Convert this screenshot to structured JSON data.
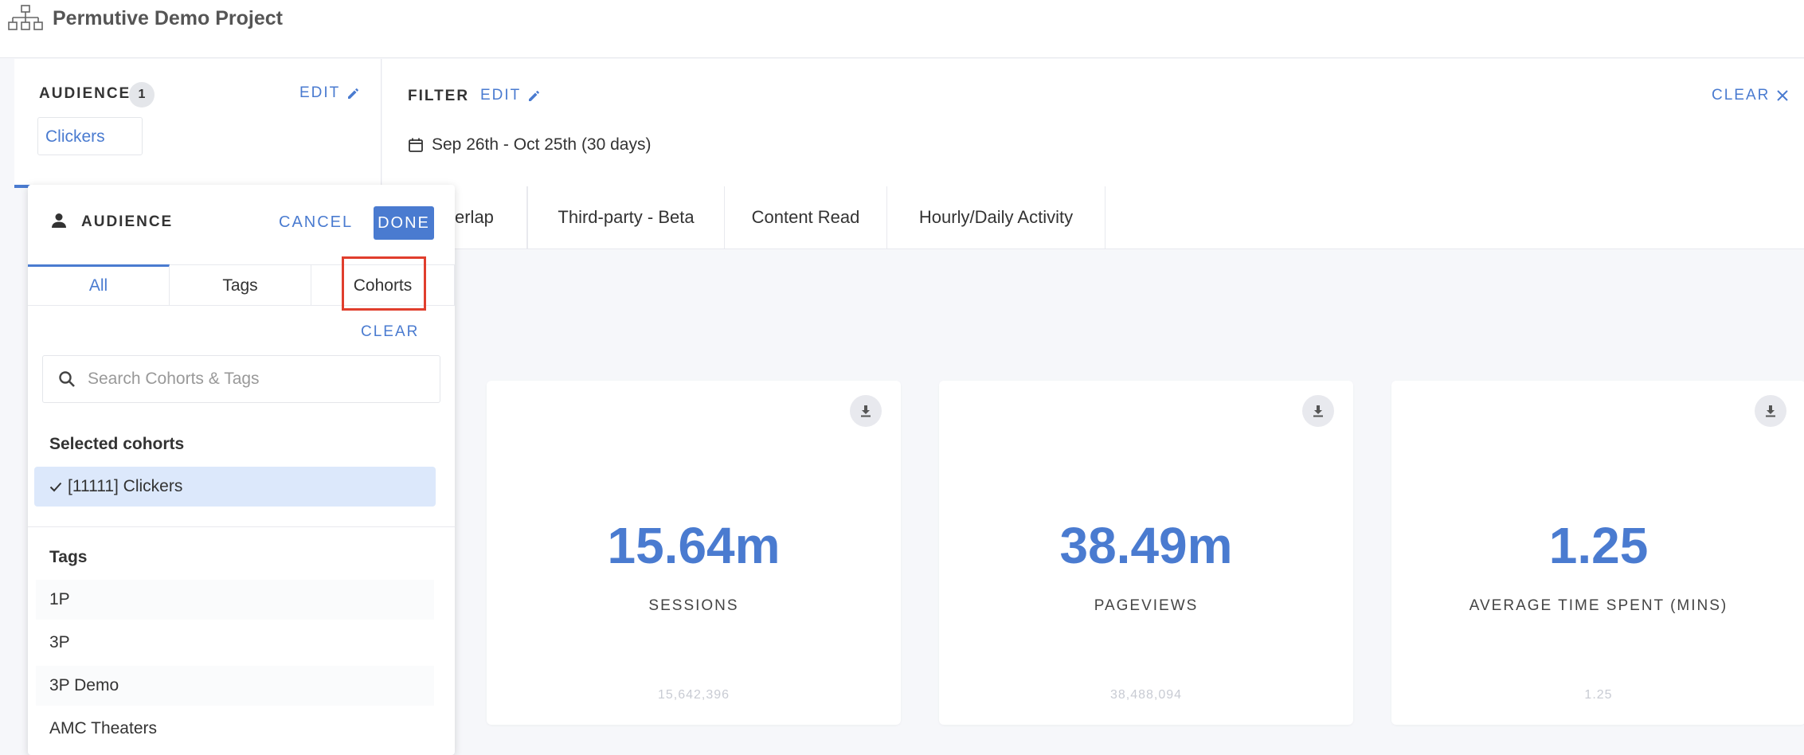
{
  "header": {
    "project_title": "Permutive Demo Project",
    "icon": "sitemap-icon"
  },
  "audience": {
    "label": "AUDIENCE",
    "count": "1",
    "edit_label": "EDIT",
    "chip": "Clickers"
  },
  "filter": {
    "label": "FILTER",
    "edit_label": "EDIT",
    "clear_label": "CLEAR",
    "date_range": "Sep 26th - Oct 25th (30 days)"
  },
  "tabs": [
    {
      "label": "verlap"
    },
    {
      "label": "Third-party - Beta"
    },
    {
      "label": "Content Read"
    },
    {
      "label": "Hourly/Daily Activity"
    }
  ],
  "metrics": [
    {
      "value": "15.64m",
      "label": "SESSIONS",
      "raw": "15,642,396"
    },
    {
      "value": "38.49m",
      "label": "PAGEVIEWS",
      "raw": "38,488,094"
    },
    {
      "value": "1.25",
      "label": "AVERAGE TIME SPENT (MINS)",
      "raw": "1.25"
    }
  ],
  "dropdown": {
    "title": "AUDIENCE",
    "cancel_label": "CANCEL",
    "done_label": "DONE",
    "tabs": [
      "All",
      "Tags",
      "Cohorts"
    ],
    "clear_label": "CLEAR",
    "search_placeholder": "Search Cohorts & Tags",
    "selected_heading": "Selected cohorts",
    "selected_item": "[11111] Clickers",
    "tags_heading": "Tags",
    "tags": [
      "1P",
      "3P",
      "3P Demo",
      "AMC Theaters"
    ]
  },
  "colors": {
    "accent": "#4a7bd0",
    "highlight": "#e03e2d",
    "selected_bg": "#dce8fb"
  }
}
